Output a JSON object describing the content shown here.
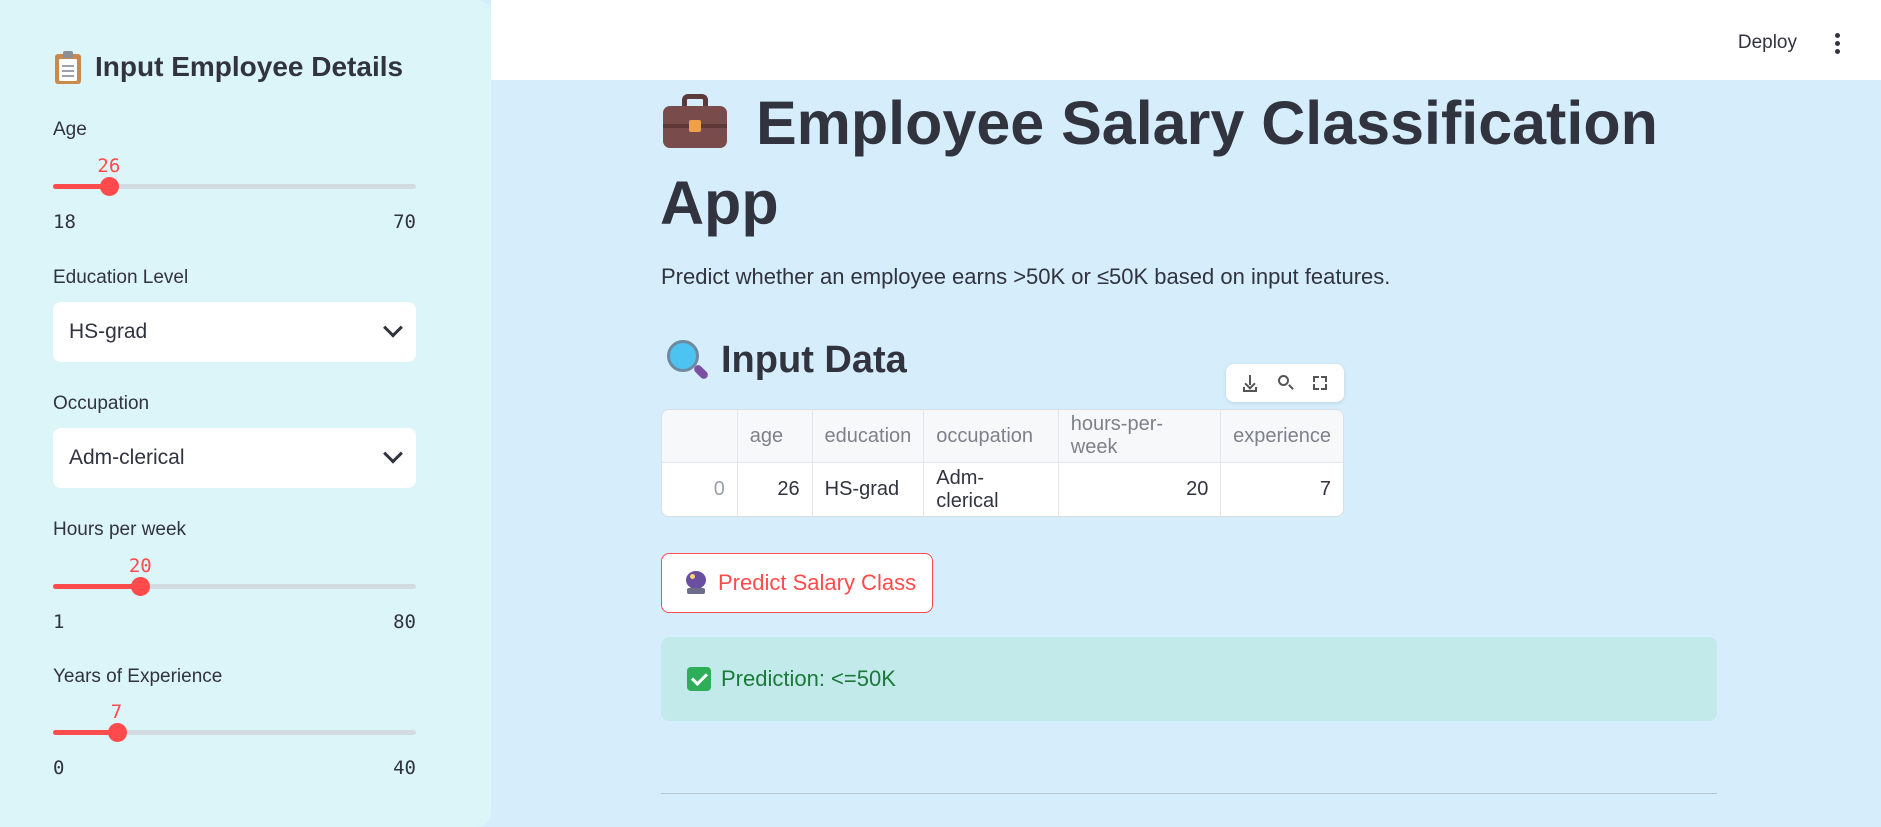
{
  "sidebar": {
    "title": "Input Employee Details",
    "age": {
      "label": "Age",
      "value": 26,
      "min": 18,
      "max": 70
    },
    "education": {
      "label": "Education Level",
      "selected": "HS-grad"
    },
    "occupation": {
      "label": "Occupation",
      "selected": "Adm-clerical"
    },
    "hours": {
      "label": "Hours per week",
      "value": 20,
      "min": 1,
      "max": 80
    },
    "experience": {
      "label": "Years of Experience",
      "value": 7,
      "min": 0,
      "max": 40
    }
  },
  "header": {
    "deploy_label": "Deploy"
  },
  "main": {
    "title": "Employee Salary Classification App",
    "description": "Predict whether an employee earns >50K or ≤50K based on input features.",
    "input_section_title": "Input Data",
    "table": {
      "columns": [
        "",
        "age",
        "education",
        "occupation",
        "hours-per-week",
        "experience"
      ],
      "rows": [
        [
          "0",
          "26",
          "HS-grad",
          "Adm-clerical",
          "20",
          "7"
        ]
      ]
    },
    "predict_button_label": "Predict Salary Class",
    "prediction_text": "Prediction: <=50K"
  },
  "colors": {
    "accent": "#ff4b4b",
    "sidebar_bg": "#dcf5f9",
    "main_bg": "#d6eefc",
    "success_bg": "#c3eaea",
    "success_text": "#1a7a3a"
  }
}
